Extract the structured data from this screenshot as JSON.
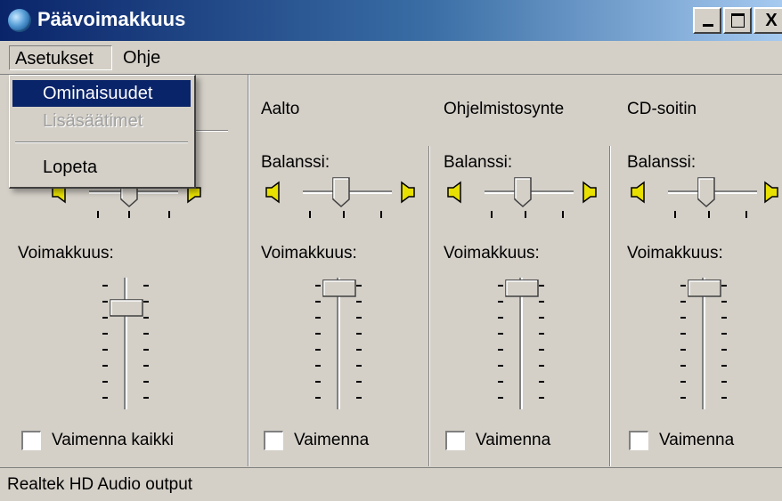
{
  "window": {
    "title": "Päävoimakkuus",
    "close_glyph": "X"
  },
  "menubar": {
    "items": [
      "Asetukset",
      "Ohje"
    ]
  },
  "dropdown": {
    "items": [
      "Ominaisuudet",
      "Lisäsäätimet",
      "Lopeta"
    ],
    "selected": "Ominaisuudet",
    "disabled": "Lisäsäätimet"
  },
  "columns": [
    {
      "title": "",
      "balance_label": "",
      "volume_label": "Voimakkuus:",
      "mute_label": "Vaimenna kaikki",
      "balance_level": 0.45,
      "volume_level": 0.75,
      "muted": false
    },
    {
      "title": "Aalto",
      "balance_label": "Balanssi:",
      "volume_label": "Voimakkuus:",
      "mute_label": "Vaimenna",
      "balance_level": 0.45,
      "volume_level": 1.0,
      "muted": false
    },
    {
      "title": "Ohjelmistosynte",
      "balance_label": "Balanssi:",
      "volume_label": "Voimakkuus:",
      "mute_label": "Vaimenna",
      "balance_level": 0.45,
      "volume_level": 1.0,
      "muted": false
    },
    {
      "title": "CD-soitin",
      "balance_label": "Balanssi:",
      "volume_label": "Voimakkuus:",
      "mute_label": "Vaimenna",
      "balance_level": 0.45,
      "volume_level": 1.0,
      "muted": false
    }
  ],
  "status": {
    "text": "Realtek HD Audio output"
  },
  "colors": {
    "face": "#d4d0c8",
    "title_start": "#0a246a",
    "title_end": "#a6caf0",
    "selection": "#0a246a",
    "speaker": "#e8e000"
  },
  "icons": {
    "app": "volume-globe-icon",
    "speaker_left": "speaker-left-icon",
    "speaker_right": "speaker-right-icon"
  }
}
